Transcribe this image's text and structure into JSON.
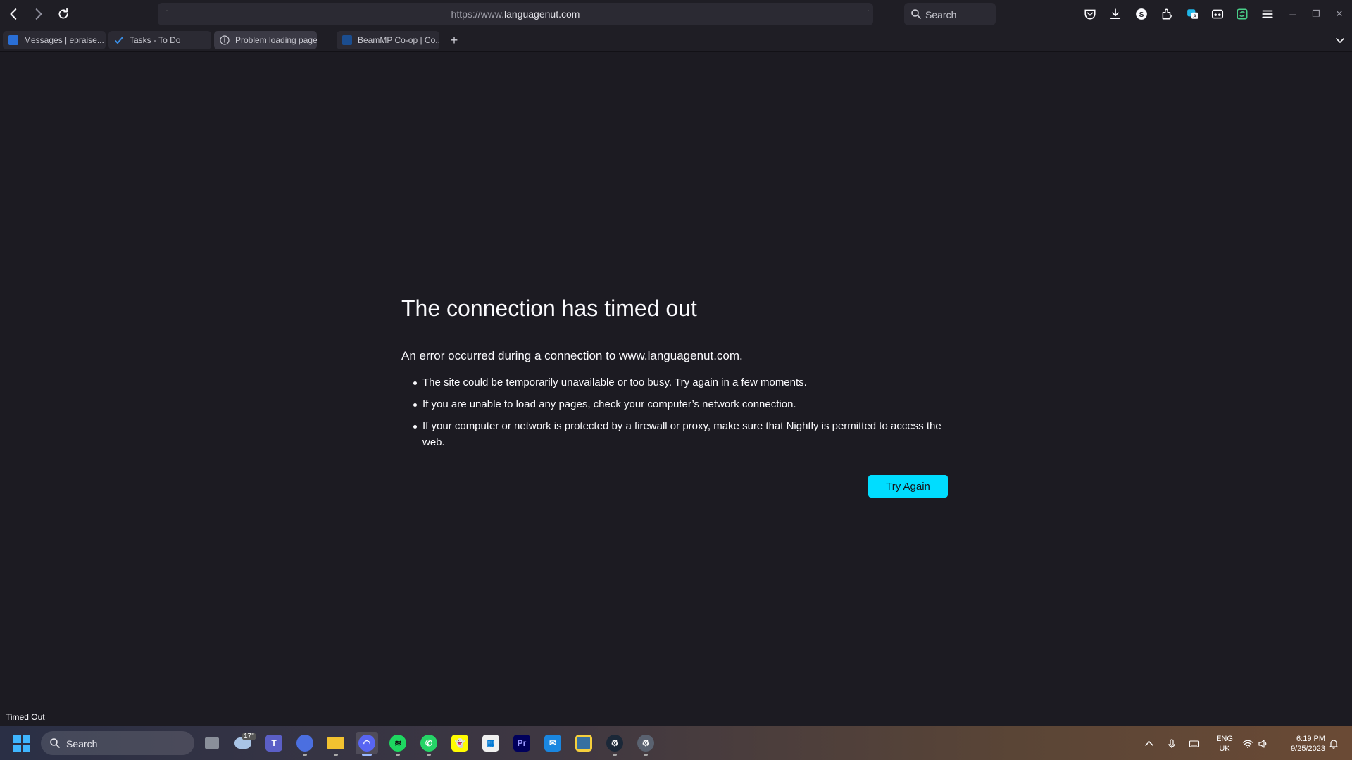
{
  "browser": {
    "url_prefix": "https://www.",
    "url_domain": "languagenut.com",
    "search_placeholder": "Search",
    "tabs": [
      {
        "title": "Messages | epraise..."
      },
      {
        "title": "Tasks - To Do"
      },
      {
        "title": "Problem loading page"
      },
      {
        "title": "BeamMP Co-op | Co..."
      }
    ],
    "new_tab_label": "+",
    "toolbar_icons": [
      "pocket-icon",
      "downloads-icon",
      "extension-s-icon",
      "extensions-icon",
      "translate-icon",
      "reader-icon",
      "sync-icon",
      "menu-icon"
    ]
  },
  "error": {
    "title": "The connection has timed out",
    "description": "An error occurred during a connection to www.languagenut.com.",
    "bullets": [
      "The site could be temporarily unavailable or too busy. Try again in a few moments.",
      "If you are unable to load any pages, check your computer’s network connection.",
      "If your computer or network is protected by a firewall or proxy, make sure that Nightly is permitted to access the web."
    ],
    "button_label": "Try Again"
  },
  "status_text": "Timed Out",
  "taskbar": {
    "search_placeholder": "Search",
    "weather_temp": "17°",
    "apps": [
      "task-view",
      "weather",
      "teams",
      "firefox-nightly",
      "file-explorer",
      "discord",
      "spotify",
      "whatsapp",
      "snapchat",
      "microsoft-store",
      "premiere-pro",
      "mail",
      "python",
      "steam",
      "settings"
    ],
    "lang_line1": "ENG",
    "lang_line2": "UK",
    "time": "6:19 PM",
    "date": "9/25/2023"
  },
  "colors": {
    "page_bg": "#1c1b22",
    "button_bg": "#00ddff",
    "chrome_bg": "#1f1e25"
  }
}
